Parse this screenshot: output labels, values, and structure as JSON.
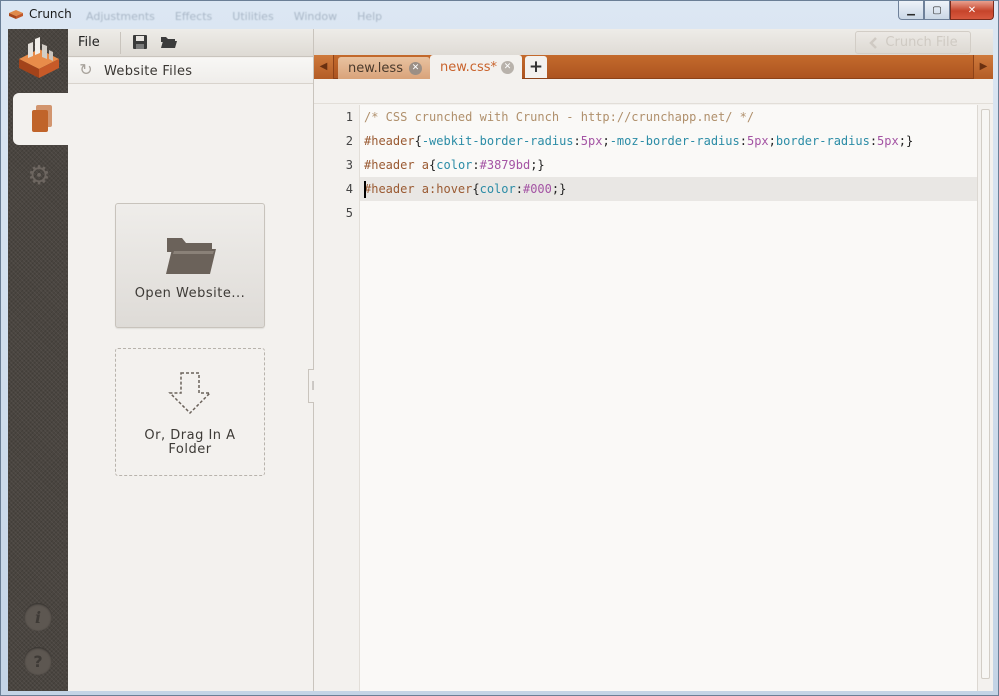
{
  "window": {
    "title": "Crunch",
    "ghost_menu": [
      "Adjustments",
      "Effects",
      "Utilities",
      "Window",
      "Help"
    ],
    "controls": {
      "minimize": "▁",
      "maximize": "▢",
      "close": "✕"
    }
  },
  "toolbar": {
    "file_label": "File",
    "crunch_button_label": "Crunch File"
  },
  "files_panel": {
    "title": "Website Files",
    "open_button_label": "Open Website...",
    "drop_label": "Or, Drag In A Folder"
  },
  "tabs": [
    {
      "label": "new.less",
      "active": false
    },
    {
      "label": "new.css*",
      "active": true
    }
  ],
  "editor": {
    "line_numbers": [
      "1",
      "2",
      "3",
      "4",
      "5"
    ],
    "current_line": 4,
    "lines": [
      [
        {
          "t": "comment",
          "v": "/* CSS crunched with Crunch - http://crunchapp.net/ */"
        }
      ],
      [
        {
          "t": "sel",
          "v": "#header"
        },
        {
          "t": "punc",
          "v": "{"
        },
        {
          "t": "prop",
          "v": "-webkit-border-radius"
        },
        {
          "t": "punc",
          "v": ":"
        },
        {
          "t": "val",
          "v": "5px"
        },
        {
          "t": "punc",
          "v": ";"
        },
        {
          "t": "prop",
          "v": "-moz-border-radius"
        },
        {
          "t": "punc",
          "v": ":"
        },
        {
          "t": "val",
          "v": "5px"
        },
        {
          "t": "punc",
          "v": ";"
        },
        {
          "t": "prop",
          "v": "border-radius"
        },
        {
          "t": "punc",
          "v": ":"
        },
        {
          "t": "val",
          "v": "5px"
        },
        {
          "t": "punc",
          "v": ";}"
        }
      ],
      [
        {
          "t": "sel",
          "v": "#header a"
        },
        {
          "t": "punc",
          "v": "{"
        },
        {
          "t": "prop",
          "v": "color"
        },
        {
          "t": "punc",
          "v": ":"
        },
        {
          "t": "val",
          "v": "#3879bd"
        },
        {
          "t": "punc",
          "v": ";}"
        }
      ],
      [
        {
          "t": "sel",
          "v": "#header a:hover"
        },
        {
          "t": "punc",
          "v": "{"
        },
        {
          "t": "prop",
          "v": "color"
        },
        {
          "t": "punc",
          "v": ":"
        },
        {
          "t": "val",
          "v": "#000"
        },
        {
          "t": "punc",
          "v": ";}"
        }
      ],
      []
    ]
  },
  "colors": {
    "accent_orange": "#c0642a",
    "rail_dark": "#4a4540",
    "panel_bg": "#f3f1ee"
  },
  "icons": {
    "app": "crunch-logo-icon",
    "save": "save-icon",
    "open": "open-folder-icon",
    "refresh": "refresh-icon",
    "files_tab": "files-icon",
    "settings": "gear-icon",
    "info": "info-icon",
    "help": "help-icon"
  }
}
